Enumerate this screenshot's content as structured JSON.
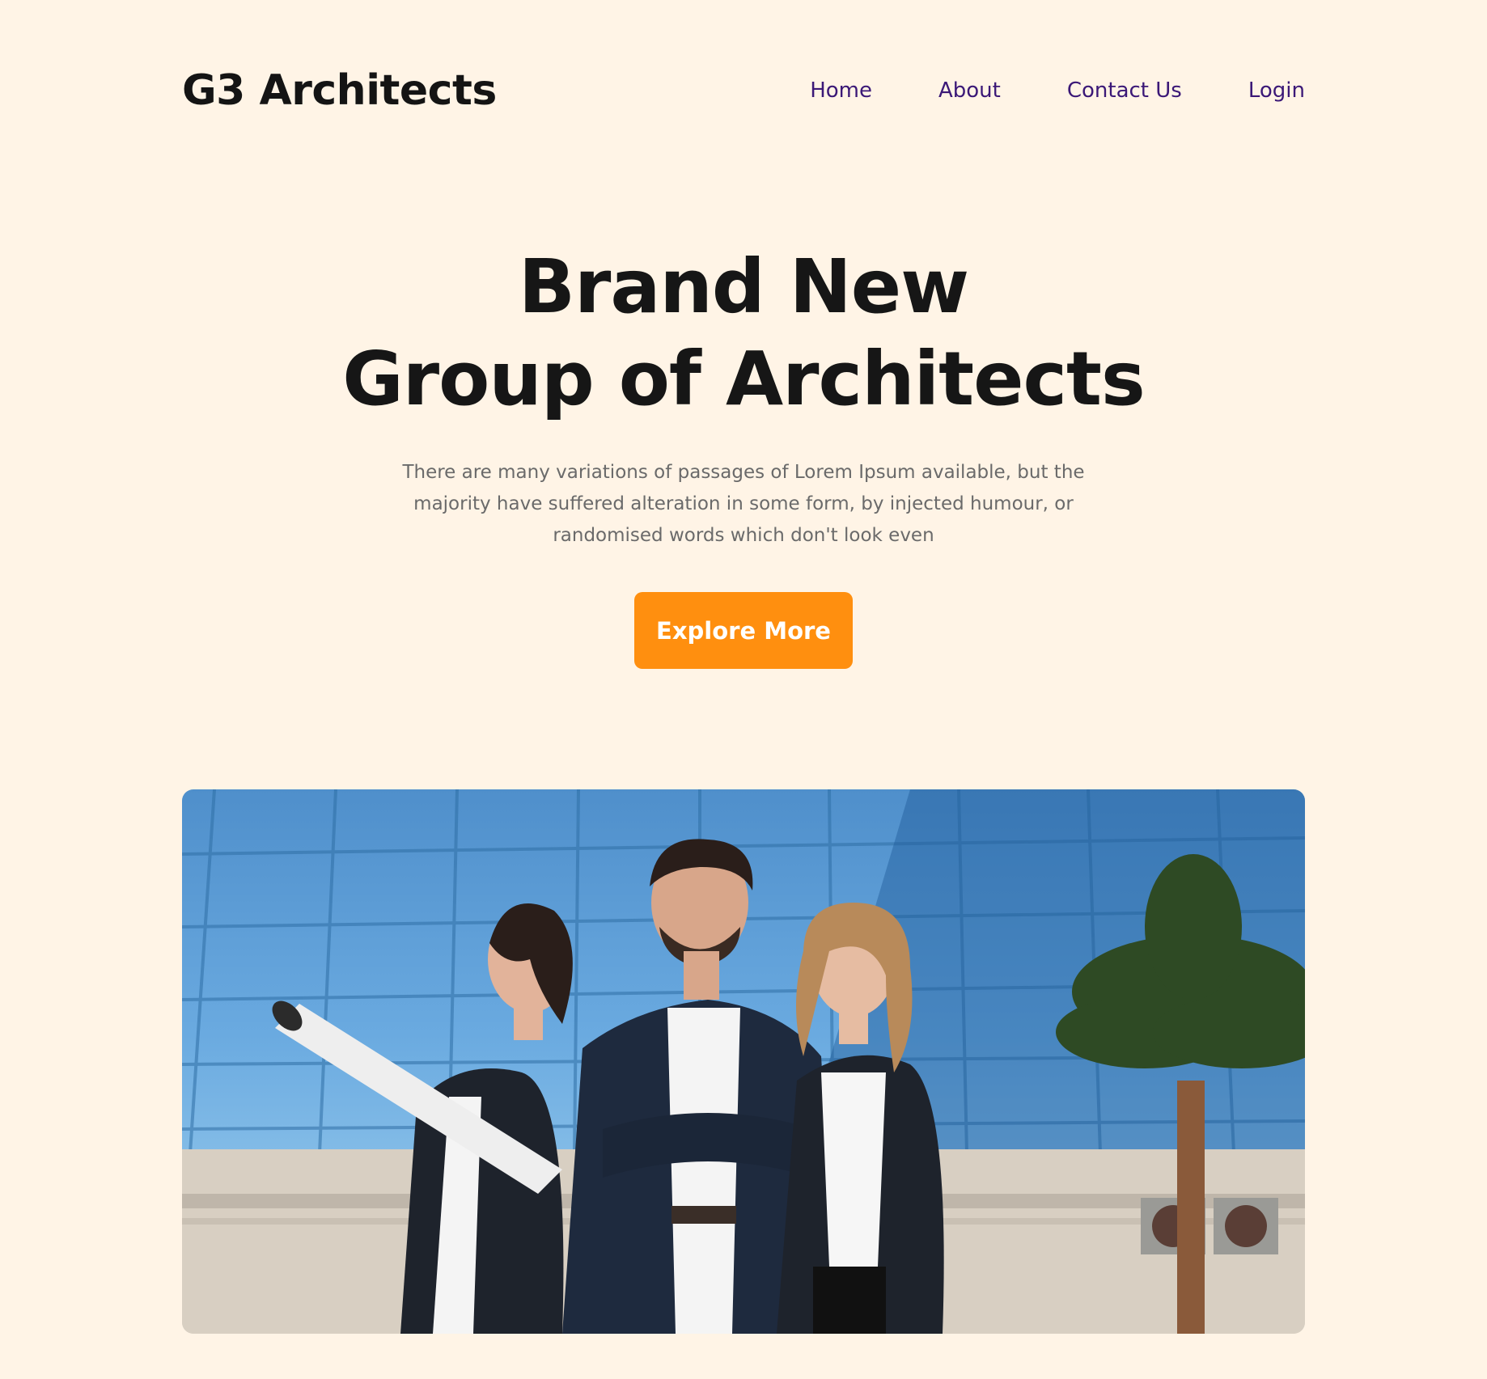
{
  "header": {
    "logo": "G3 Architects",
    "nav": [
      {
        "label": "Home"
      },
      {
        "label": "About"
      },
      {
        "label": "Contact Us"
      },
      {
        "label": "Login"
      }
    ]
  },
  "hero": {
    "title_line1": "Brand New",
    "title_line2": "Group of Architects",
    "description": "There are many variations of passages of Lorem Ipsum available, but the majority have suffered alteration in some form, by injected humour, or randomised words which don't look even",
    "cta_label": "Explore More"
  },
  "colors": {
    "background": "#FFF4E6",
    "accent": "#FF8F0F",
    "nav_link": "#3B1877",
    "heading": "#161616",
    "body_text": "#6A6A6A"
  }
}
